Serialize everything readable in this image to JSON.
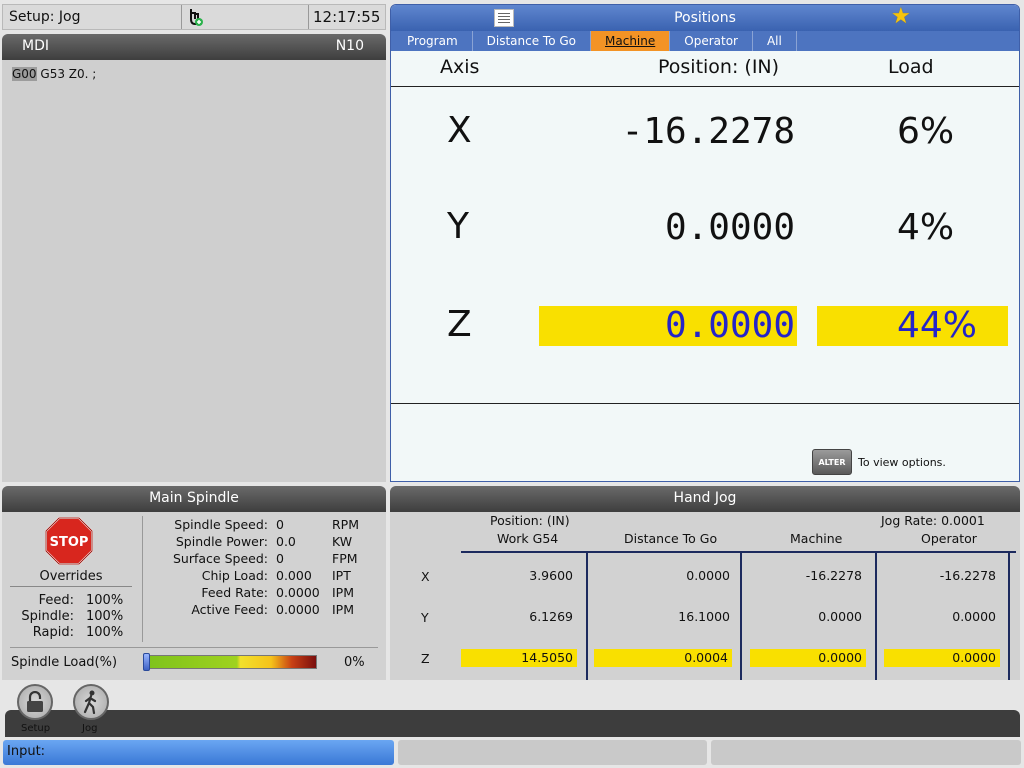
{
  "status": {
    "mode": "Setup: Jog",
    "time": "12:17:55",
    "icon": "hand-jog-icon"
  },
  "mdi": {
    "title": "MDI",
    "line": "N10",
    "code_hl": "G00",
    "code_rest": " G53 Z0. ;"
  },
  "positions": {
    "title": "Positions",
    "tabs": [
      "Program",
      "Distance To Go",
      "Machine",
      "Operator",
      "All"
    ],
    "active_tab": "Machine",
    "col_axis": "Axis",
    "col_position": "Position:  (IN)",
    "col_load": "Load",
    "rows": [
      {
        "axis": "X",
        "value": "-16.2278",
        "load": "6%"
      },
      {
        "axis": "Y",
        "value": "0.0000",
        "load": "4%"
      },
      {
        "axis": "Z",
        "value": "0.0000",
        "load": "44%"
      }
    ],
    "alter_key": "ALTER",
    "alter_text": "To view options."
  },
  "spindle": {
    "title": "Main Spindle",
    "stop_label": "STOP",
    "overrides_title": "Overrides",
    "overrides": [
      {
        "label": "Feed:",
        "value": "100%"
      },
      {
        "label": "Spindle:",
        "value": "100%"
      },
      {
        "label": "Rapid:",
        "value": "100%"
      }
    ],
    "stats": [
      {
        "label": "Spindle Speed:",
        "value": "0",
        "unit": "RPM"
      },
      {
        "label": "Spindle Power:",
        "value": "0.0",
        "unit": "KW"
      },
      {
        "label": "Surface Speed:",
        "value": "0",
        "unit": "FPM"
      },
      {
        "label": "Chip Load:",
        "value": "0.000",
        "unit": "IPT"
      },
      {
        "label": "Feed Rate:",
        "value": "0.0000",
        "unit": "IPM"
      },
      {
        "label": "Active Feed:",
        "value": "0.0000",
        "unit": "IPM"
      }
    ],
    "load_label": "Spindle Load(%)",
    "load_value": "0%",
    "load_fraction": 0
  },
  "jog": {
    "title": "Hand Jog",
    "position_label": "Position: (IN)",
    "jog_rate": "Jog Rate: 0.0001",
    "columns": [
      "Work G54",
      "Distance To Go",
      "Machine",
      "Operator"
    ],
    "rows": [
      {
        "axis": "X",
        "values": [
          "3.9600",
          "0.0000",
          "-16.2278",
          "-16.2278"
        ]
      },
      {
        "axis": "Y",
        "values": [
          "6.1269",
          "16.1000",
          "0.0000",
          "0.0000"
        ]
      },
      {
        "axis": "Z",
        "values": [
          "14.5050",
          "0.0004",
          "0.0000",
          "0.0000"
        ]
      }
    ]
  },
  "softkeys": [
    {
      "label": "Setup",
      "icon": "lock-icon"
    },
    {
      "label": "Jog",
      "icon": "walking-person-icon"
    }
  ],
  "input": {
    "label": "Input:"
  }
}
